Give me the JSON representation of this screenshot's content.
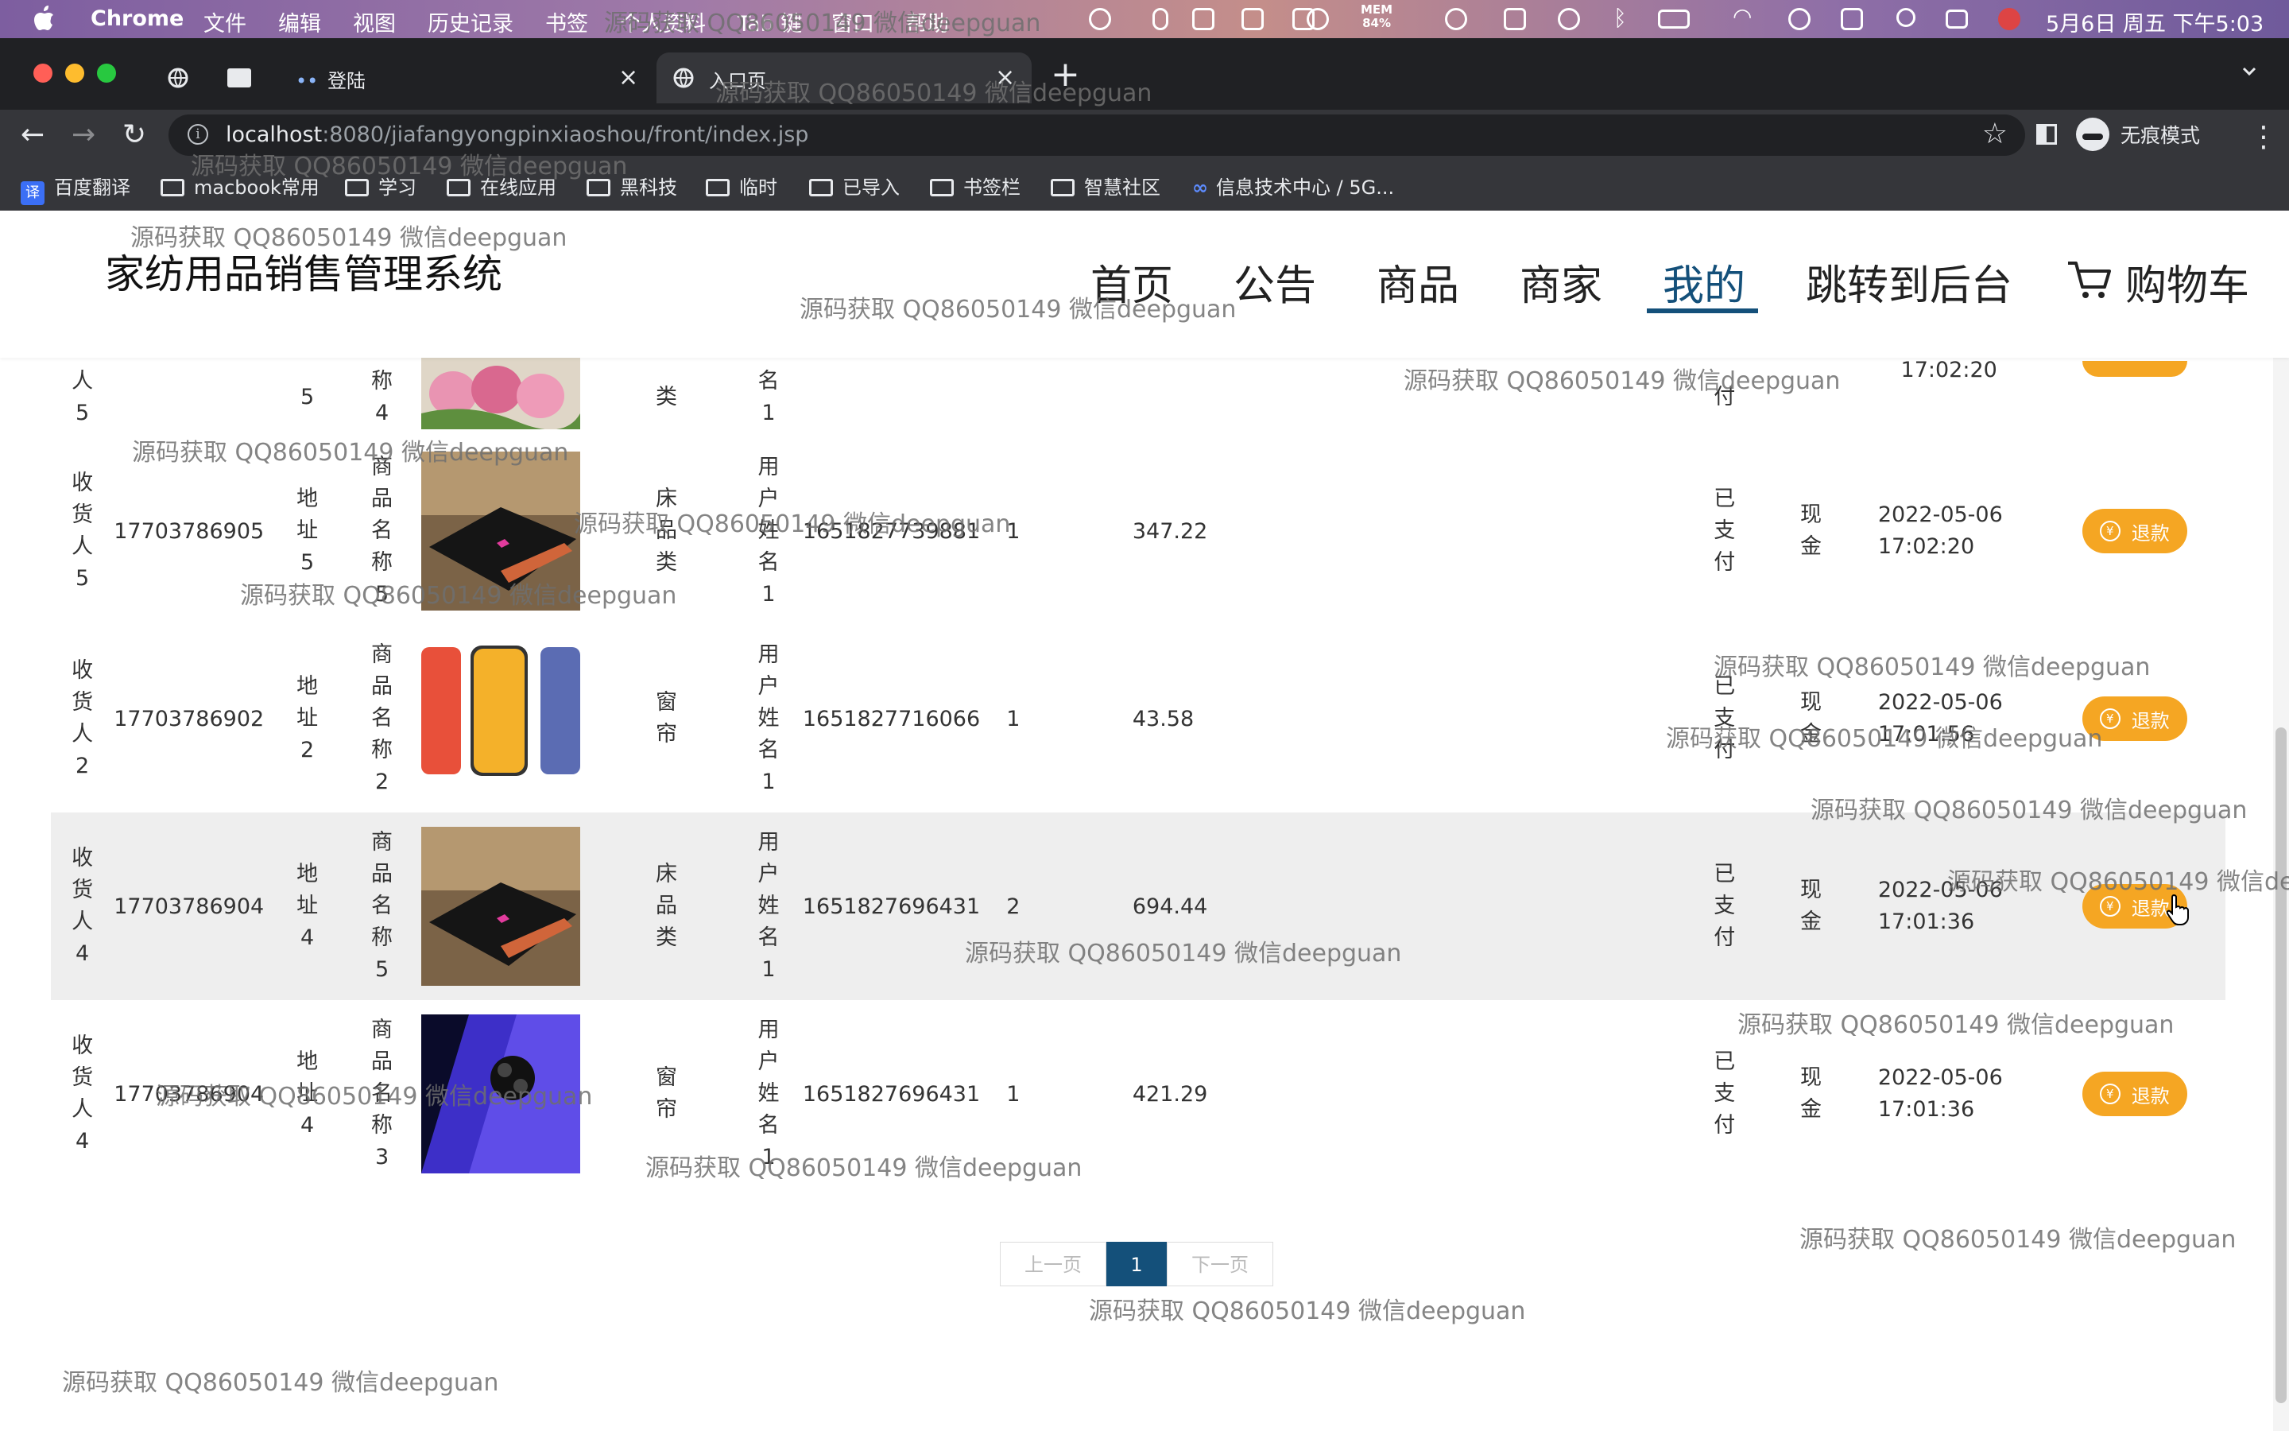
{
  "menubar": {
    "app_name": "Chrome",
    "items": [
      "文件",
      "编辑",
      "视图",
      "历史记录",
      "书签",
      "个人资料",
      "Tab 键",
      "窗口",
      "帮助"
    ],
    "mem_label": "MEM",
    "mem_value": "84%",
    "datetime": "5月6日 周五 下午5:03"
  },
  "tabs": [
    {
      "title": "登陆",
      "active": false
    },
    {
      "title": "入口页",
      "active": true
    }
  ],
  "toolbar": {
    "url_host": "localhost",
    "url_path": ":8080/jiafangyongpinxiaoshou/front/index.jsp",
    "profile_label": "无痕模式"
  },
  "bookmarks": [
    "百度翻译",
    "macbook常用",
    "学习",
    "在线应用",
    "黑科技",
    "临时",
    "已导入",
    "书签栏",
    "智慧社区",
    "信息技术中心 / 5G..."
  ],
  "site": {
    "title": "家纺用品销售管理系统",
    "nav": [
      "首页",
      "公告",
      "商品",
      "商家",
      "我的",
      "跳转到后台",
      "购物车"
    ],
    "active_nav": "我的"
  },
  "orders": {
    "partial_row": {
      "receiver": "人5",
      "address": "5",
      "product": "称4",
      "category": "类",
      "user": "名1",
      "status": "付",
      "time": "17:02:20"
    },
    "rows": [
      {
        "receiver": "收货人5",
        "phone": "17703786905",
        "address": "地址5",
        "product": "商品名称5",
        "image": "laptop",
        "category": "床品类",
        "user": "用户姓名1",
        "order_no": "1651827739881",
        "qty": "1",
        "amount": "347.22",
        "status": "已支付",
        "pay": "现金",
        "date": "2022-05-06",
        "time": "17:02:20",
        "action": "退款"
      },
      {
        "receiver": "收货人2",
        "phone": "17703786902",
        "address": "地址2",
        "product": "商品名称2",
        "image": "phones",
        "category": "窗帘",
        "user": "用户姓名1",
        "order_no": "1651827716066",
        "qty": "1",
        "amount": "43.58",
        "status": "已支付",
        "pay": "现金",
        "date": "2022-05-06",
        "time": "17:01:56",
        "action": "退款"
      },
      {
        "receiver": "收货人4",
        "phone": "17703786904",
        "address": "地址4",
        "product": "商品名称5",
        "image": "laptop",
        "category": "床品类",
        "user": "用户姓名1",
        "order_no": "1651827696431",
        "qty": "2",
        "amount": "694.44",
        "status": "已支付",
        "pay": "现金",
        "date": "2022-05-06",
        "time": "17:01:36",
        "action": "退款"
      },
      {
        "receiver": "收货人4",
        "phone": "17703786904",
        "address": "地址4",
        "product": "商品名称3",
        "image": "purple-phone",
        "category": "窗帘",
        "user": "用户姓名1",
        "order_no": "1651827696431",
        "qty": "1",
        "amount": "421.29",
        "status": "已支付",
        "pay": "现金",
        "date": "2022-05-06",
        "time": "17:01:36",
        "action": "退款"
      }
    ]
  },
  "pagination": {
    "prev": "上一页",
    "current": "1",
    "next": "下一页"
  },
  "watermark_text": "源码获取 QQ86050149 微信deepguan"
}
